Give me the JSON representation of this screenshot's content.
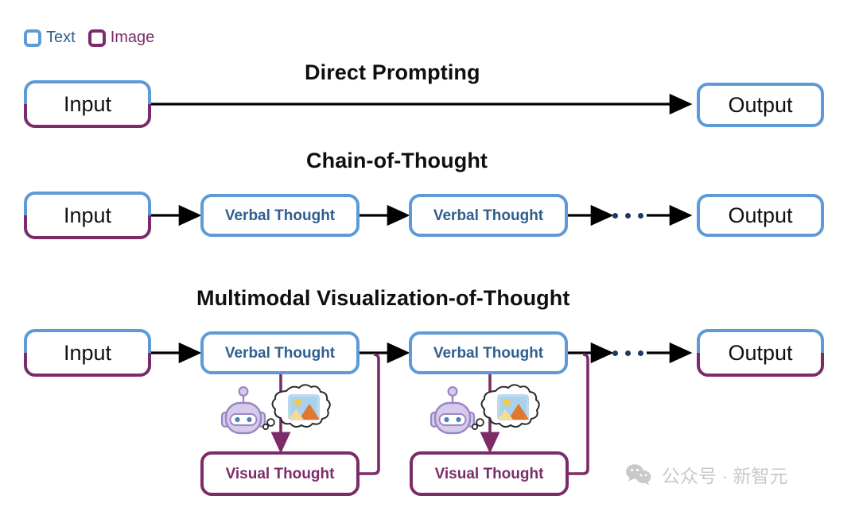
{
  "legend": {
    "items": [
      {
        "label": "Text",
        "swatch": "text-swatch-blue",
        "color": "#5E9BD6"
      },
      {
        "label": "Image",
        "swatch": "image-swatch-purple",
        "color": "#7B2C68"
      }
    ]
  },
  "colors": {
    "text_blue": "#5E9BD6",
    "text_blue_label": "#2E5F8F",
    "image_purple": "#7B2C68",
    "arrow_black": "#000000",
    "ellipsis_dot": "#1F3864",
    "robot_body": "#CFC2E8",
    "watermark_gray": "#C9C9C9"
  },
  "sections": [
    {
      "id": "direct-prompting",
      "title": "Direct Prompting",
      "nodes": [
        {
          "name": "input-box",
          "label": "Input",
          "style": "dual"
        },
        {
          "name": "output-box",
          "label": "Output",
          "style": "blue"
        }
      ]
    },
    {
      "id": "chain-of-thought",
      "title": "Chain-of-Thought",
      "nodes": [
        {
          "name": "input-box",
          "label": "Input",
          "style": "dual"
        },
        {
          "name": "verbal-thought-box",
          "label": "Verbal Thought",
          "style": "blue"
        },
        {
          "name": "verbal-thought-box",
          "label": "Verbal Thought",
          "style": "blue"
        },
        {
          "name": "output-box",
          "label": "Output",
          "style": "blue"
        }
      ],
      "ellipsis": "..."
    },
    {
      "id": "multimodal-visualization-of-thought",
      "title": "Multimodal Visualization-of-Thought",
      "nodes": [
        {
          "name": "input-box",
          "label": "Input",
          "style": "dual"
        },
        {
          "name": "verbal-thought-box",
          "label": "Verbal Thought",
          "style": "blue"
        },
        {
          "name": "verbal-thought-box",
          "label": "Verbal Thought",
          "style": "blue"
        },
        {
          "name": "output-box",
          "label": "Output",
          "style": "dual"
        },
        {
          "name": "visual-thought-box",
          "label": "Visual Thought",
          "style": "purple"
        },
        {
          "name": "visual-thought-box",
          "label": "Visual Thought",
          "style": "purple"
        }
      ],
      "ellipsis": "...",
      "icons": [
        {
          "name": "robot-icon",
          "alt": "robot"
        },
        {
          "name": "image-thought-bubble-icon",
          "alt": "thought bubble with picture"
        },
        {
          "name": "robot-icon",
          "alt": "robot"
        },
        {
          "name": "image-thought-bubble-icon",
          "alt": "thought bubble with picture"
        }
      ]
    }
  ],
  "watermark": {
    "icon": "wechat-icon",
    "text": "公众号 · 新智元"
  }
}
